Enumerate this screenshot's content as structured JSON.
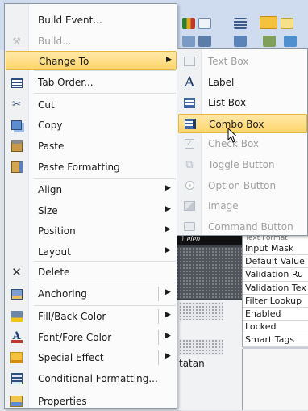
{
  "app": {
    "design_header_text": "ℐ ᥱᥣᥱᥒ",
    "design_partial_text": "tatan"
  },
  "property_sheet": {
    "rows": [
      "Input Mask",
      "Default Value",
      "Validation Ru",
      "Validation Tex",
      "Filter Lookup",
      "Enabled",
      "Locked",
      "Smart Tags"
    ],
    "partial_top_row": "Text Format"
  },
  "context_menu": {
    "items": [
      {
        "id": "build-event",
        "label": "Build Event...",
        "icon": "none",
        "disabled": false
      },
      {
        "id": "build",
        "label": "Build...",
        "icon": "build-wand-icon",
        "disabled": true
      },
      {
        "id": "change-to",
        "label": "Change To",
        "icon": "none",
        "disabled": false,
        "submenu": true,
        "highlighted": true
      },
      {
        "id": "tab-order",
        "label": "Tab Order...",
        "icon": "tab-order-icon",
        "disabled": false
      },
      {
        "id": "cut",
        "label": "Cut",
        "icon": "scissors-icon",
        "disabled": false
      },
      {
        "id": "copy",
        "label": "Copy",
        "icon": "copy-icon",
        "disabled": false
      },
      {
        "id": "paste",
        "label": "Paste",
        "icon": "paste-icon",
        "disabled": false
      },
      {
        "id": "paste-formatting",
        "label": "Paste Formatting",
        "icon": "paste-formatting-icon",
        "disabled": false
      },
      {
        "id": "align",
        "label": "Align",
        "icon": "none",
        "disabled": false,
        "submenu": true
      },
      {
        "id": "size",
        "label": "Size",
        "icon": "none",
        "disabled": false,
        "submenu": true
      },
      {
        "id": "position",
        "label": "Position",
        "icon": "none",
        "disabled": false,
        "submenu": true
      },
      {
        "id": "layout",
        "label": "Layout",
        "icon": "none",
        "disabled": false,
        "submenu": true
      },
      {
        "id": "delete",
        "label": "Delete",
        "icon": "delete-x-icon",
        "disabled": false
      },
      {
        "id": "anchoring",
        "label": "Anchoring",
        "icon": "anchoring-icon",
        "disabled": false,
        "submenu": true
      },
      {
        "id": "fill-back-color",
        "label": "Fill/Back Color",
        "icon": "fill-color-icon",
        "disabled": false,
        "submenu": true
      },
      {
        "id": "font-fore-color",
        "label": "Font/Fore Color",
        "icon": "font-color-icon",
        "disabled": false,
        "submenu": true
      },
      {
        "id": "special-effect",
        "label": "Special Effect",
        "icon": "special-effect-icon",
        "disabled": false,
        "submenu": true
      },
      {
        "id": "conditional-formatting",
        "label": "Conditional Formatting...",
        "icon": "conditional-formatting-icon",
        "disabled": false
      },
      {
        "id": "properties",
        "label": "Properties",
        "icon": "properties-icon",
        "disabled": false
      }
    ]
  },
  "change_to_submenu": {
    "items": [
      {
        "id": "text-box",
        "label": "Text Box",
        "icon": "text-box-icon",
        "disabled": true
      },
      {
        "id": "label",
        "label": "Label",
        "icon": "label-icon",
        "disabled": false
      },
      {
        "id": "list-box",
        "label": "List Box",
        "icon": "list-box-icon",
        "disabled": false
      },
      {
        "id": "combo-box",
        "label": "Combo Box",
        "icon": "combo-box-icon",
        "disabled": false,
        "highlighted": true
      },
      {
        "id": "check-box",
        "label": "Check Box",
        "icon": "check-box-icon",
        "disabled": true
      },
      {
        "id": "toggle-button",
        "label": "Toggle Button",
        "icon": "toggle-button-icon",
        "disabled": true
      },
      {
        "id": "option-button",
        "label": "Option Button",
        "icon": "option-button-icon",
        "disabled": true
      },
      {
        "id": "image",
        "label": "Image",
        "icon": "image-icon",
        "disabled": true
      },
      {
        "id": "command-button",
        "label": "Command Button",
        "icon": "command-button-icon",
        "disabled": true
      }
    ]
  },
  "colors": {
    "highlight": "#ffd56c",
    "highlight_border": "#e5b83c",
    "disabled_text": "#9a9a9a",
    "ribbon": "#cfdcef"
  }
}
